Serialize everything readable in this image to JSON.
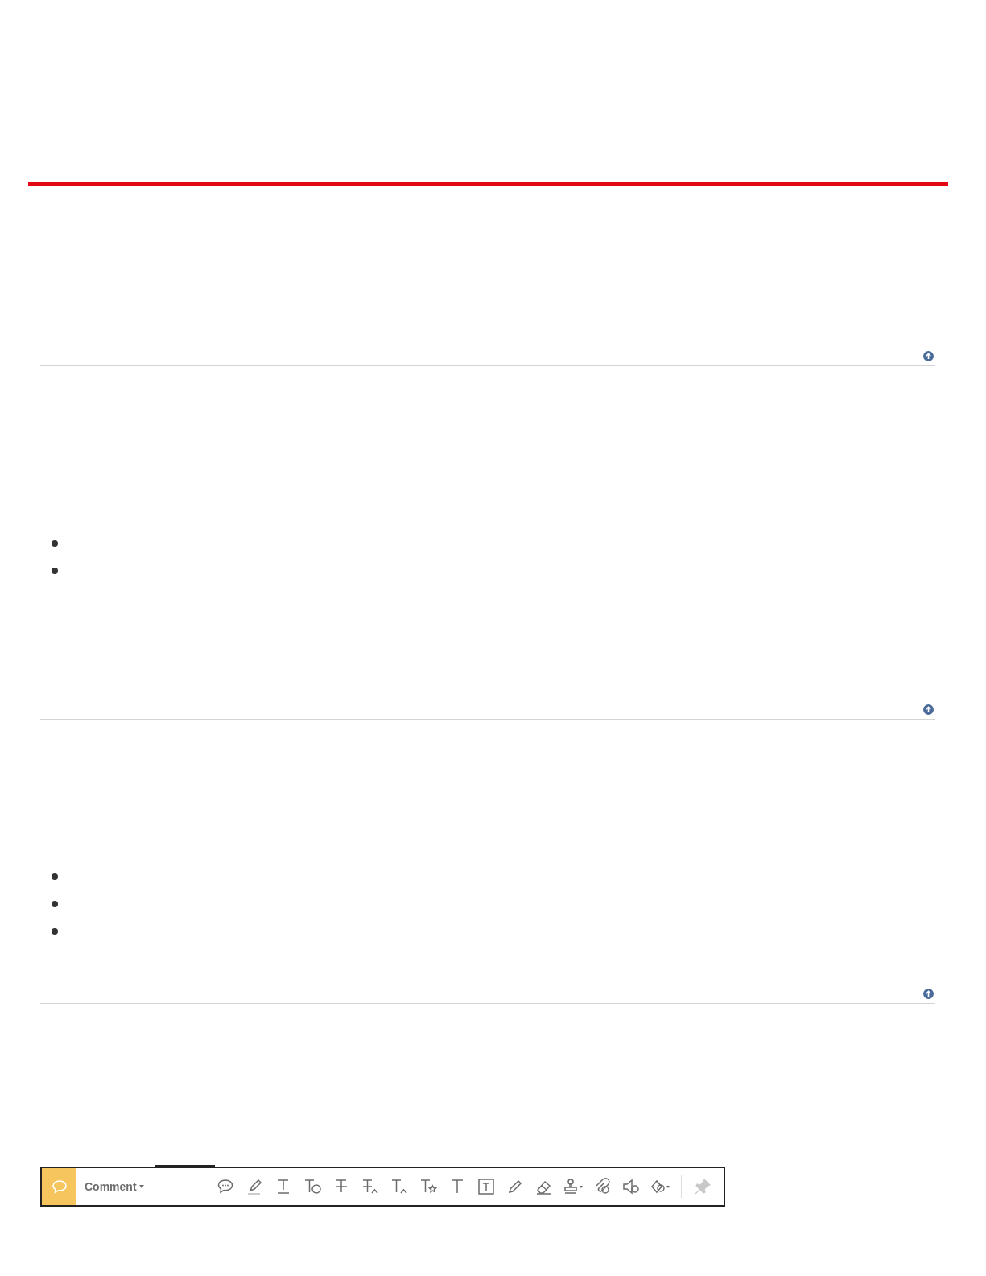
{
  "sections": [
    {
      "kind": "plain"
    },
    {
      "kind": "list",
      "items": [
        {
          "kind": "bullet"
        },
        {
          "kind": "bullet"
        }
      ]
    },
    {
      "kind": "list",
      "items": [
        {
          "kind": "bullet"
        },
        {
          "kind": "bullet"
        },
        {
          "kind": "bullet"
        }
      ]
    }
  ],
  "toolbar": {
    "label": "Comment",
    "tools": [
      {
        "kind": "speech"
      },
      {
        "kind": "highlight"
      },
      {
        "kind": "underline"
      },
      {
        "kind": "text-note"
      },
      {
        "kind": "strike"
      },
      {
        "kind": "replace"
      },
      {
        "kind": "insert"
      },
      {
        "kind": "star-text"
      },
      {
        "kind": "text"
      },
      {
        "kind": "textbox"
      },
      {
        "kind": "pencil"
      },
      {
        "kind": "eraser"
      },
      {
        "kind": "stamp"
      },
      {
        "kind": "attach"
      },
      {
        "kind": "sound"
      },
      {
        "kind": "shapes"
      },
      {
        "kind": "pin"
      }
    ]
  }
}
